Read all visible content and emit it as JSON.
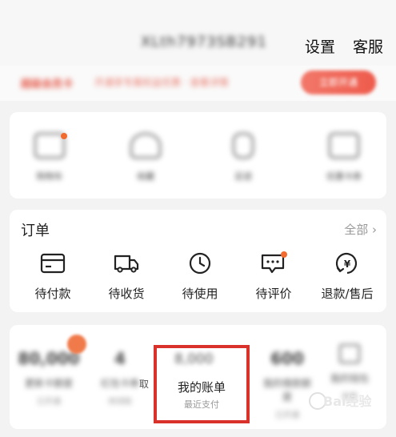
{
  "header": {
    "account_id": "XLth7973SB291",
    "settings_label": "设置",
    "service_label": "客服"
  },
  "promo": {
    "title": "超级会员卡",
    "text": "开通享专属权益优惠 · 查看详情",
    "button": "立即开通"
  },
  "quick": [
    {
      "label": "购物车",
      "icon": "cart-icon"
    },
    {
      "label": "收藏",
      "icon": "star-icon"
    },
    {
      "label": "足迹",
      "icon": "footprint-icon"
    },
    {
      "label": "优惠卡券",
      "icon": "coupon-icon"
    }
  ],
  "orders": {
    "title": "订单",
    "all_label": "全部",
    "items": [
      {
        "label": "待付款",
        "icon": "wallet-icon"
      },
      {
        "label": "待收货",
        "icon": "truck-icon"
      },
      {
        "label": "待使用",
        "icon": "clock-icon"
      },
      {
        "label": "待评价",
        "icon": "comment-icon"
      },
      {
        "label": "退款/售后",
        "icon": "refund-icon"
      }
    ]
  },
  "stats": [
    {
      "num": "80,000",
      "label": "更新卡额度",
      "sub": "已开通"
    },
    {
      "num": "4",
      "label": "红包卡券",
      "sub": "待领取"
    },
    {
      "num": "8,000",
      "label": "我的账单",
      "sub": "最近支付",
      "highlighted": true
    },
    {
      "num": "600",
      "label": "我的借款额度",
      "sub": "已开通"
    },
    {
      "num": "",
      "label": "我的钱包",
      "sub": "查看"
    }
  ],
  "partial_text": "取",
  "watermark": "Bai经验"
}
